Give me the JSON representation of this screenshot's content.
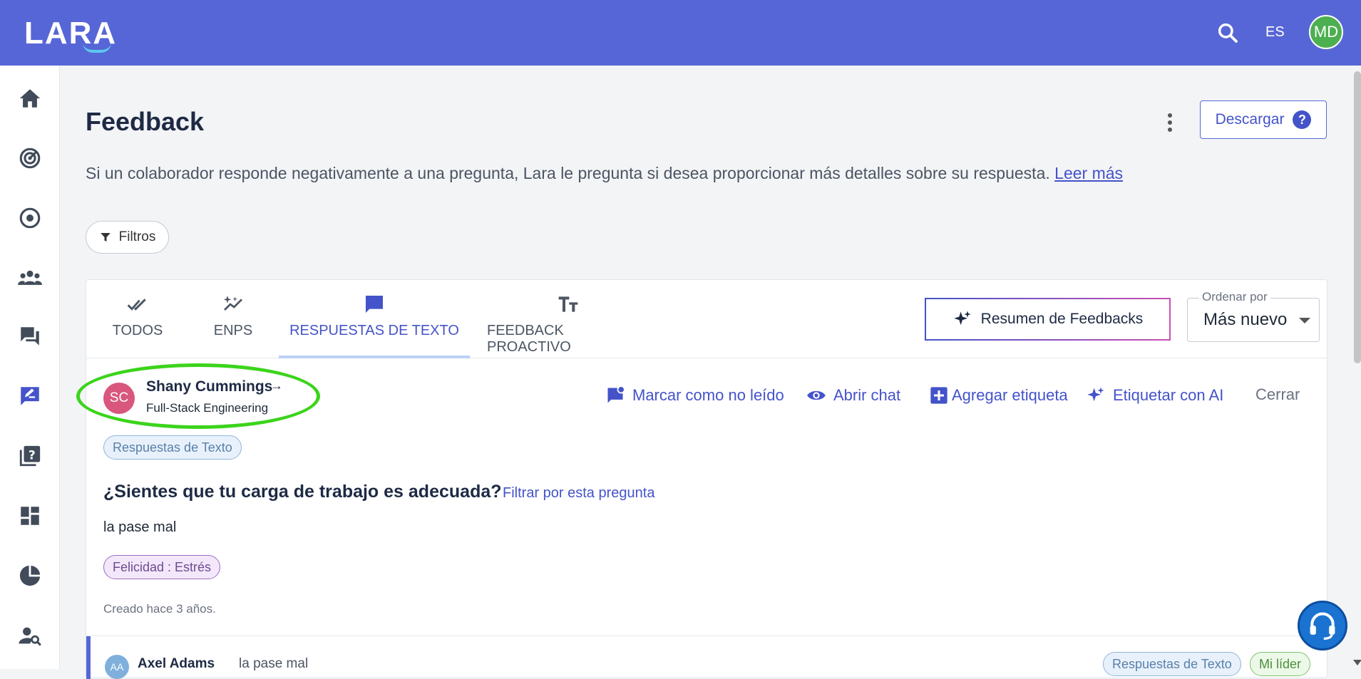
{
  "header": {
    "logo_text": "LARA",
    "language": "ES",
    "avatar_initials": "MD",
    "accent_color": "#5766d6"
  },
  "sidebar": {
    "items": [
      {
        "icon": "home-icon"
      },
      {
        "icon": "radar-icon"
      },
      {
        "icon": "target-icon"
      },
      {
        "icon": "team-icon"
      },
      {
        "icon": "chat-icon"
      },
      {
        "icon": "feedback-icon",
        "active": true
      },
      {
        "icon": "question-book-icon"
      },
      {
        "icon": "dashboard-icon"
      },
      {
        "icon": "pie-chart-icon"
      },
      {
        "icon": "user-search-icon"
      }
    ]
  },
  "page": {
    "title": "Feedback",
    "download_label": "Descargar",
    "help_label": "?",
    "description": "Si un colaborador responde negativamente a una pregunta, Lara le pregunta si desea proporcionar más detalles sobre su respuesta.",
    "read_more": "Leer más",
    "filters_label": "Filtros"
  },
  "tabs": [
    {
      "label": "TODOS",
      "icon": "double-check-icon"
    },
    {
      "label": "ENPS",
      "icon": "sparkle-chart-icon"
    },
    {
      "label": "RESPUESTAS DE TEXTO",
      "icon": "message-icon",
      "active": true
    },
    {
      "label": "FEEDBACK PROACTIVO",
      "icon": "text-size-icon"
    }
  ],
  "toolbar": {
    "summary_label": "Resumen de Feedbacks",
    "order_label": "Ordenar por",
    "order_value": "Más nuevo"
  },
  "feedback": {
    "avatar_initials": "SC",
    "name": "Shany Cummings",
    "name_arrow": "→",
    "team": "Full-Stack Engineering",
    "actions": {
      "mark_unread": "Marcar como no leído",
      "open_chat": "Abrir chat",
      "add_tag": "Agregar etiqueta",
      "tag_ai": "Etiquetar con AI",
      "close": "Cerrar"
    },
    "type_chip": "Respuestas de Texto",
    "question": "¿Sientes que tu carga de trabajo es adecuada?",
    "filter_question": "Filtrar por esta pregunta",
    "answer": "la pase mal",
    "tag_chip": "Felicidad : Estrés",
    "created": "Creado hace 3 años."
  },
  "feedback2": {
    "avatar_initials": "AA",
    "name": "Axel Adams",
    "snippet": "la pase mal",
    "type_chip": "Respuestas de Texto",
    "role_chip": "Mi líder"
  }
}
